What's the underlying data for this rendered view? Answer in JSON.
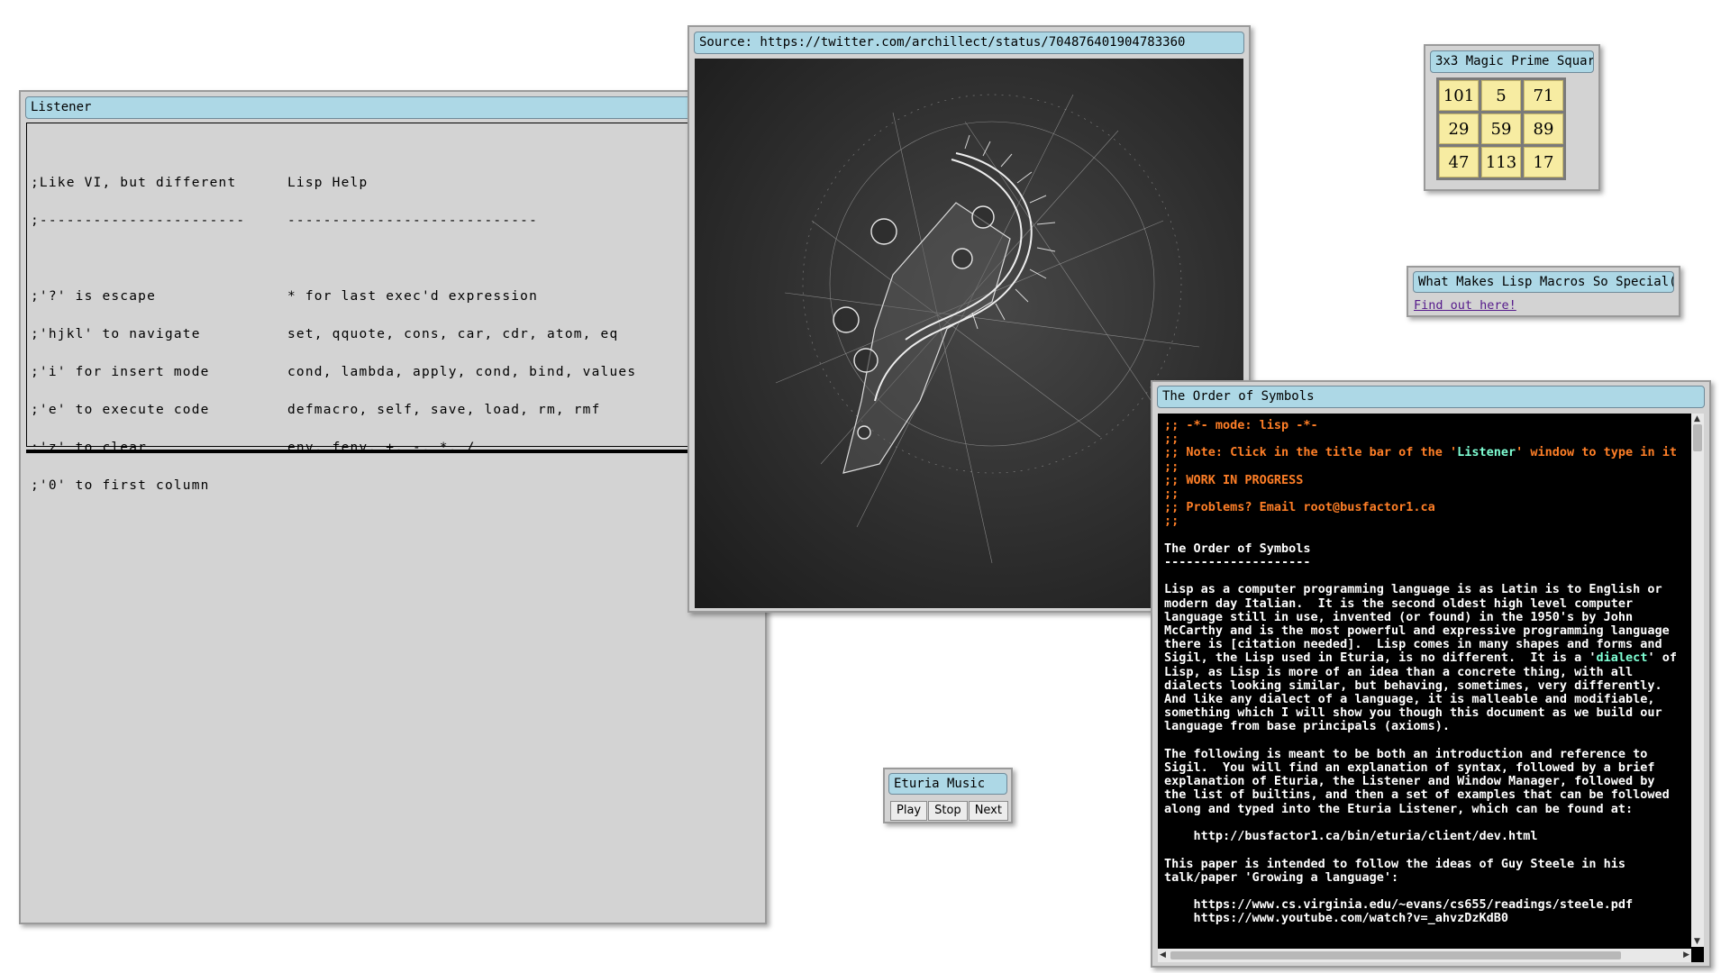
{
  "listener": {
    "title": "Listener",
    "left_column": [
      ";Like VI, but different",
      ";-----------------------",
      "",
      ";'?' is escape",
      ";'hjkl' to navigate",
      ";'i' for insert mode",
      ";'e' to execute code",
      ";'z' to clear",
      ";'0' to first column"
    ],
    "right_column": [
      "Lisp Help",
      "----------------------------",
      "",
      "* for last exec'd expression",
      "set, qquote, cons, car, cdr, atom, eq",
      "cond, lambda, apply, cond, bind, values",
      "defmacro, self, save, load, rm, rmf",
      "env, fenv, +, -, *, /",
      ""
    ]
  },
  "image_window": {
    "title": "Source: https://twitter.com/archillect/status/704876401904783360"
  },
  "magic_square": {
    "title": "3x3 Magic Prime Square",
    "cells": [
      "101",
      "5",
      "71",
      "29",
      "59",
      "89",
      "47",
      "113",
      "17"
    ]
  },
  "macros_window": {
    "title": "What Makes Lisp Macros So Special(?)",
    "link": "Find out here!"
  },
  "music": {
    "title": "Eturia Music",
    "play": "Play",
    "stop": "Stop",
    "next": "Next"
  },
  "order": {
    "title": "The Order of Symbols",
    "c1": ";; -*- mode: lisp -*-",
    "c2": ";;",
    "c3a": ";; Note: Click in the title bar of the '",
    "c3b": "Listener",
    "c3c": "' window to type in it",
    "c4": ";;",
    "c5": ";; WORK IN PROGRESS",
    "c6": ";;",
    "c7": ";; Problems? Email root@busfactor1.ca",
    "c8": ";;",
    "heading": "The Order of Symbols",
    "rule": "--------------------",
    "p1a": "Lisp as a computer programming language is as Latin is to English or\nmodern day Italian.  It is the second oldest high level computer\nlanguage still in use, invented (or found) in the 1950's by John\nMcCarthy and is the most powerful and expressive programming language\nthere is [citation needed].  Lisp comes in many shapes and forms and\nSigil, the Lisp used in Eturia, is no different.  It is a '",
    "p1b": "dialect",
    "p1c": "' of\nLisp, as Lisp is more of an idea than a concrete thing, with all\ndialects looking similar, but behaving, sometimes, very differently.\nAnd like any dialect of a language, it is malleable and modifiable,\nsomething which I will show you though this document as we build our\nlanguage from base principals (axioms).",
    "p2": "The following is meant to be both an introduction and reference to\nSigil.  You will find an explanation of syntax, followed by a brief\nexplanation of Eturia, the Listener and Window Manager, followed by\nthe list of builtins, and then a set of examples that can be followed\nalong and typed into the Eturia Listener, which can be found at:",
    "url1": "    http://busfactor1.ca/bin/eturia/client/dev.html",
    "p3": "This paper is intended to follow the ideas of Guy Steele in his\ntalk/paper 'Growing a language':",
    "url2": "    https://www.cs.virginia.edu/~evans/cs655/readings/steele.pdf",
    "url3": "    https://www.youtube.com/watch?v=_ahvzDzKdB0"
  },
  "colors": {
    "titlebar": "#add8e6",
    "window": "#d3d3d3",
    "comment": "#ff7f27",
    "highlight": "#7fffd4",
    "magic_cell": "#f7eca2"
  }
}
